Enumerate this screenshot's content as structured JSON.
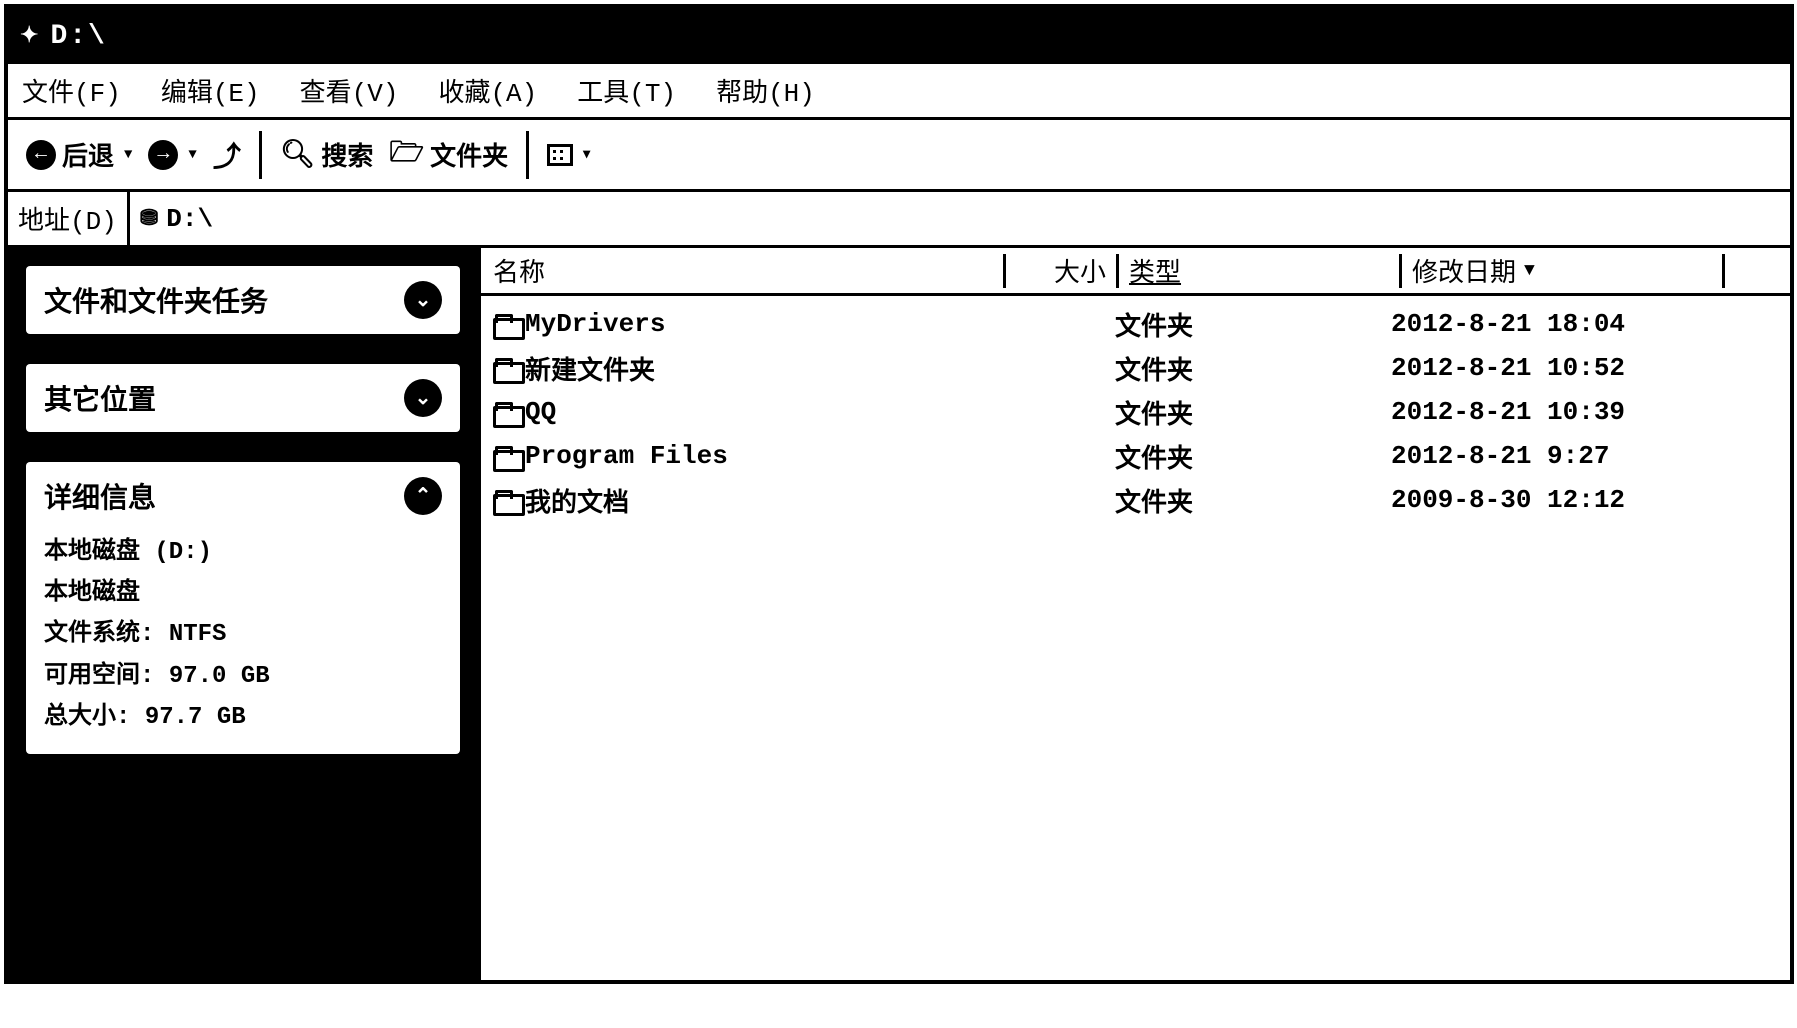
{
  "title": "D:\\",
  "menubar": {
    "file": "文件(F)",
    "edit": "编辑(E)",
    "view": "查看(V)",
    "favorites": "收藏(A)",
    "tools": "工具(T)",
    "help": "帮助(H)"
  },
  "toolbar": {
    "back": "后退",
    "search": "搜索",
    "folders": "文件夹"
  },
  "addressbar": {
    "label": "地址(D)",
    "value": "D:\\"
  },
  "sidebar": {
    "tasks_title": "文件和文件夹任务",
    "places_title": "其它位置",
    "details_title": "详细信息",
    "details": {
      "name": "本地磁盘 (D:)",
      "kind": "本地磁盘",
      "fs_label": "文件系统:",
      "fs_value": "NTFS",
      "free_label": "可用空间:",
      "free_value": "97.0 GB",
      "total_label": "总大小:",
      "total_value": "97.7 GB"
    }
  },
  "columns": {
    "name": "名称",
    "size": "大小",
    "type": "类型",
    "date": "修改日期"
  },
  "items": [
    {
      "name": "MyDrivers",
      "size": "",
      "type": "文件夹",
      "date": "2012-8-21 18:04"
    },
    {
      "name": "新建文件夹",
      "size": "",
      "type": "文件夹",
      "date": "2012-8-21 10:52"
    },
    {
      "name": "QQ",
      "size": "",
      "type": "文件夹",
      "date": "2012-8-21 10:39"
    },
    {
      "name": "Program Files",
      "size": "",
      "type": "文件夹",
      "date": "2012-8-21 9:27"
    },
    {
      "name": "我的文档",
      "size": "",
      "type": "文件夹",
      "date": "2009-8-30 12:12"
    }
  ]
}
